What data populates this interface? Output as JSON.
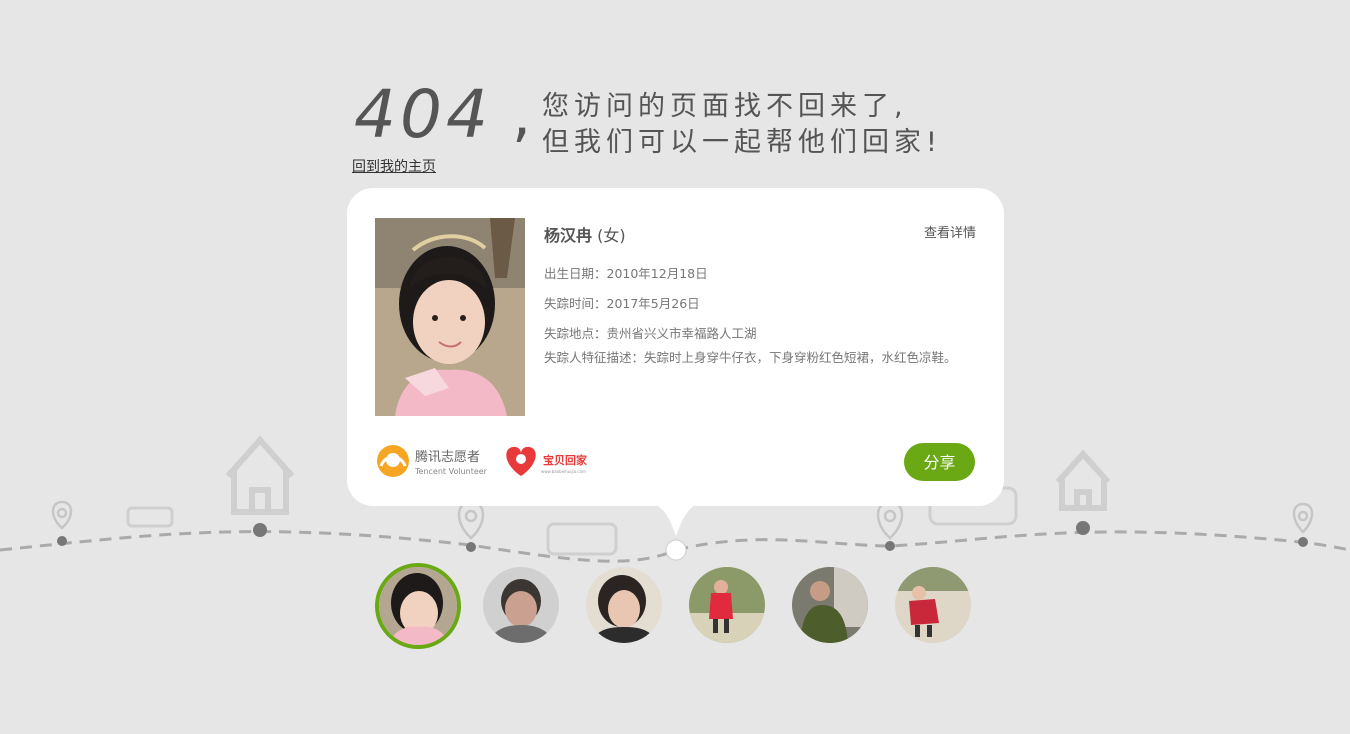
{
  "header": {
    "code": "404",
    "comma": ",",
    "line1": "您访问的页面找不回来了,",
    "line2": "但我们可以一起帮他们回家!",
    "home_link": "回到我的主页"
  },
  "card": {
    "name": "杨汉冉",
    "gender": "(女)",
    "detail_link": "查看详情",
    "birth": "出生日期：2010年12月18日",
    "missing_time": "失踪时间：2017年5月26日",
    "missing_place": "失踪地点：贵州省兴义市幸福路人工湖",
    "description": "失踪人特征描述：失踪时上身穿牛仔衣，下身穿粉红色短裙，水红色凉鞋。",
    "share_label": "分享",
    "logos": {
      "tencent_cn": "腾讯志愿者",
      "tencent_en": "Tencent Volunteer",
      "baobei_cn": "宝贝回家",
      "baobei_en": "www.baobeihuijia.com"
    }
  },
  "colors": {
    "accent": "#6aa814",
    "background": "#e6e6e6",
    "card": "#ffffff",
    "timeline": "#aaaaaa"
  },
  "thumbnails": [
    {
      "name": "thumb-1",
      "active": true
    },
    {
      "name": "thumb-2",
      "active": false
    },
    {
      "name": "thumb-3",
      "active": false
    },
    {
      "name": "thumb-4",
      "active": false
    },
    {
      "name": "thumb-5",
      "active": false
    },
    {
      "name": "thumb-6",
      "active": false
    }
  ]
}
